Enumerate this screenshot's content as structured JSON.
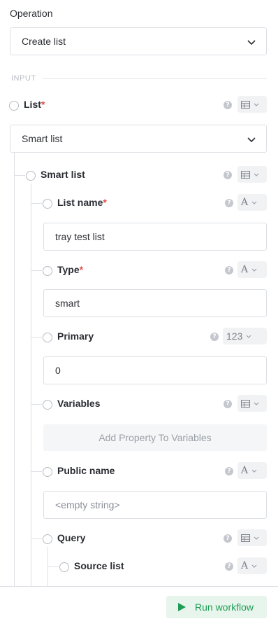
{
  "operation": {
    "label": "Operation",
    "value": "Create list"
  },
  "section": {
    "input_label": "INPUT"
  },
  "fields": {
    "list": {
      "label": "List",
      "required_mark": "*",
      "type_icon": "table-icon",
      "selected": "Smart list"
    },
    "smart_list": {
      "label": "Smart list",
      "type_icon": "table-icon"
    },
    "list_name": {
      "label": "List name",
      "required_mark": "*",
      "type_icon": "text-icon",
      "type_glyph": "A",
      "value": "tray test list"
    },
    "type": {
      "label": "Type",
      "required_mark": "*",
      "type_icon": "text-icon",
      "type_glyph": "A",
      "value": "smart"
    },
    "primary": {
      "label": "Primary",
      "type_icon": "number-icon",
      "type_glyph": "123",
      "value": "0"
    },
    "variables": {
      "label": "Variables",
      "type_icon": "table-icon",
      "add_label": "Add Property To Variables"
    },
    "public_name": {
      "label": "Public name",
      "type_icon": "text-icon",
      "type_glyph": "A",
      "placeholder": "<empty string>"
    },
    "query": {
      "label": "Query",
      "type_icon": "table-icon"
    },
    "source_list": {
      "label": "Source list",
      "type_icon": "text-icon",
      "type_glyph": "A"
    }
  },
  "help_glyph": "?",
  "footer": {
    "run_label": "Run workflow"
  },
  "colors": {
    "accent_green": "#1f9d55",
    "required_red": "#e04d4d",
    "border": "#dcdfe4"
  }
}
